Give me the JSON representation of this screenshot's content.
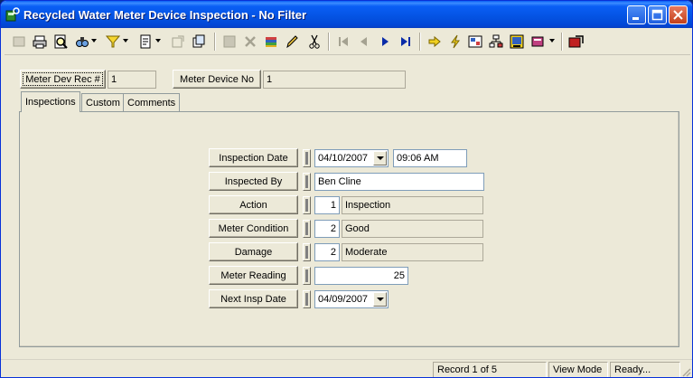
{
  "window": {
    "title": "Recycled Water Meter Device Inspection - No Filter"
  },
  "header": {
    "rec_label": "Meter Dev Rec #",
    "rec_value": "1",
    "device_label": "Meter Device No",
    "device_value": "1"
  },
  "tabs": [
    {
      "label": "Inspections",
      "active": true
    },
    {
      "label": "Custom",
      "active": false
    },
    {
      "label": "Comments",
      "active": false
    }
  ],
  "form": {
    "inspection_date": {
      "label": "Inspection Date",
      "date": "04/10/2007",
      "time": "09:06 AM"
    },
    "inspected_by": {
      "label": "Inspected By",
      "value": "Ben Cline"
    },
    "action": {
      "label": "Action",
      "code": "1",
      "description": "Inspection"
    },
    "meter_condition": {
      "label": "Meter Condition",
      "code": "2",
      "description": "Good"
    },
    "damage": {
      "label": "Damage",
      "code": "2",
      "description": "Moderate"
    },
    "meter_reading": {
      "label": "Meter Reading",
      "value": "25"
    },
    "next_insp_date": {
      "label": "Next Insp Date",
      "date": "04/09/2007"
    }
  },
  "status": {
    "record": "Record 1 of 5",
    "mode": "View Mode",
    "state": "Ready..."
  },
  "colors": {
    "titlebar": "#0453e2",
    "window_bg": "#ece9d8",
    "close_button": "#c3401b"
  }
}
